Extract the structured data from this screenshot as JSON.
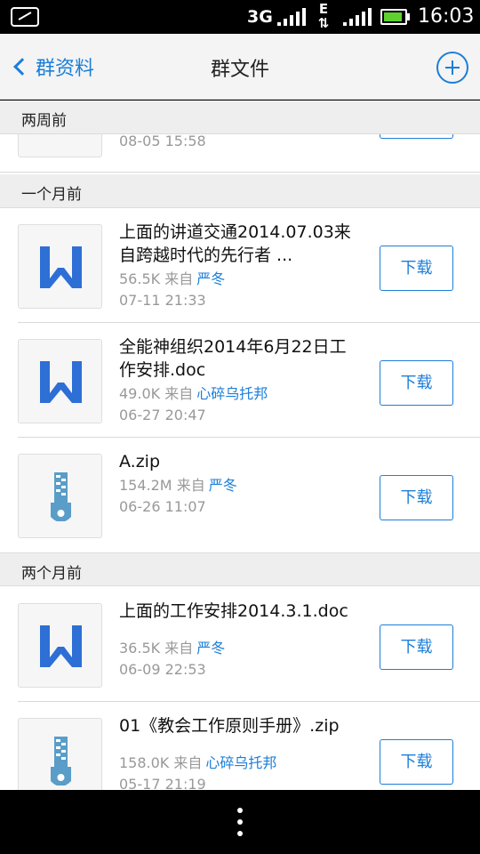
{
  "status_bar": {
    "network": "3G",
    "data_type": "E",
    "time": "16:03",
    "battery_level": 0.9,
    "battery_color": "#5fd12f"
  },
  "header": {
    "back_label": "群资料",
    "title": "群文件"
  },
  "sections": [
    {
      "label": "两周前"
    },
    {
      "label": "一个月前"
    },
    {
      "label": "两个月前"
    }
  ],
  "partial_file": {
    "date": "08-05 15:58"
  },
  "files": [
    {
      "type": "word-icon",
      "name": "上面的讲道交通2014.07.03来自跨越时代的先行者 ...",
      "size": "56.5K",
      "from": "来自",
      "uploader": "严冬",
      "date": "07-11 21:33",
      "button": "下载"
    },
    {
      "type": "word-icon",
      "name": "全能神组织2014年6月22日工作安排.doc",
      "size": "49.0K",
      "from": "来自",
      "uploader": "心碎乌托邦",
      "date": "06-27 20:47",
      "button": "下载"
    },
    {
      "type": "zip-icon",
      "name": "A.zip",
      "size": "154.2M",
      "from": "来自",
      "uploader": "严冬",
      "date": "06-26 11:07",
      "button": "下载"
    },
    {
      "type": "word-icon",
      "name": "上面的工作安排2014.3.1.doc",
      "size": "36.5K",
      "from": "来自",
      "uploader": "严冬",
      "date": "06-09 22:53",
      "button": "下载"
    },
    {
      "type": "zip-icon",
      "name": "01《教会工作原则手册》.zip",
      "size": "158.0K",
      "from": "来自",
      "uploader": "心碎乌托邦",
      "date": "05-17 21:19",
      "button": "下载"
    }
  ],
  "colors": {
    "accent": "#1c7ed8",
    "word_icon": "#2e6fd6",
    "zip_icon": "#5a9dc8"
  }
}
